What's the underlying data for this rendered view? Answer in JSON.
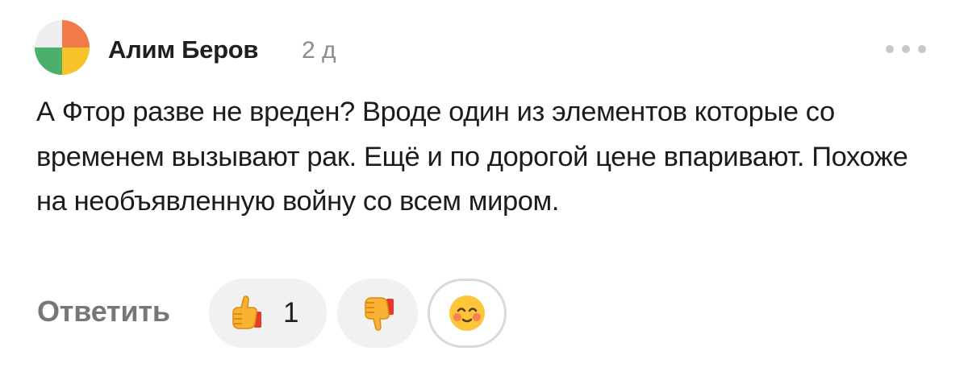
{
  "comment": {
    "author": "Алим Беров",
    "time_ago": "2 д",
    "text": "А Фтор разве не вреден? Вроде один из элементов которые со временем вызывают рак. Ещё и по дорогой цене впаривают. Похоже на необъявленную войну со всем миром."
  },
  "actions": {
    "reply_label": "Ответить",
    "like_count": "1"
  },
  "icons": {
    "avatar": "avatar-icon",
    "more": "more-dots-icon",
    "like": "thumbs-up-icon",
    "dislike": "thumbs-down-icon",
    "emoji": "smiling-face-icon"
  },
  "colors": {
    "avatar_orange": "#f07a4a",
    "avatar_green": "#4caf6a",
    "avatar_yellow": "#f7c22a",
    "avatar_light": "#eeeeee",
    "author": "#1f1f1f",
    "muted": "#8c8c8c",
    "reaction_background": "#f1f1f1"
  }
}
